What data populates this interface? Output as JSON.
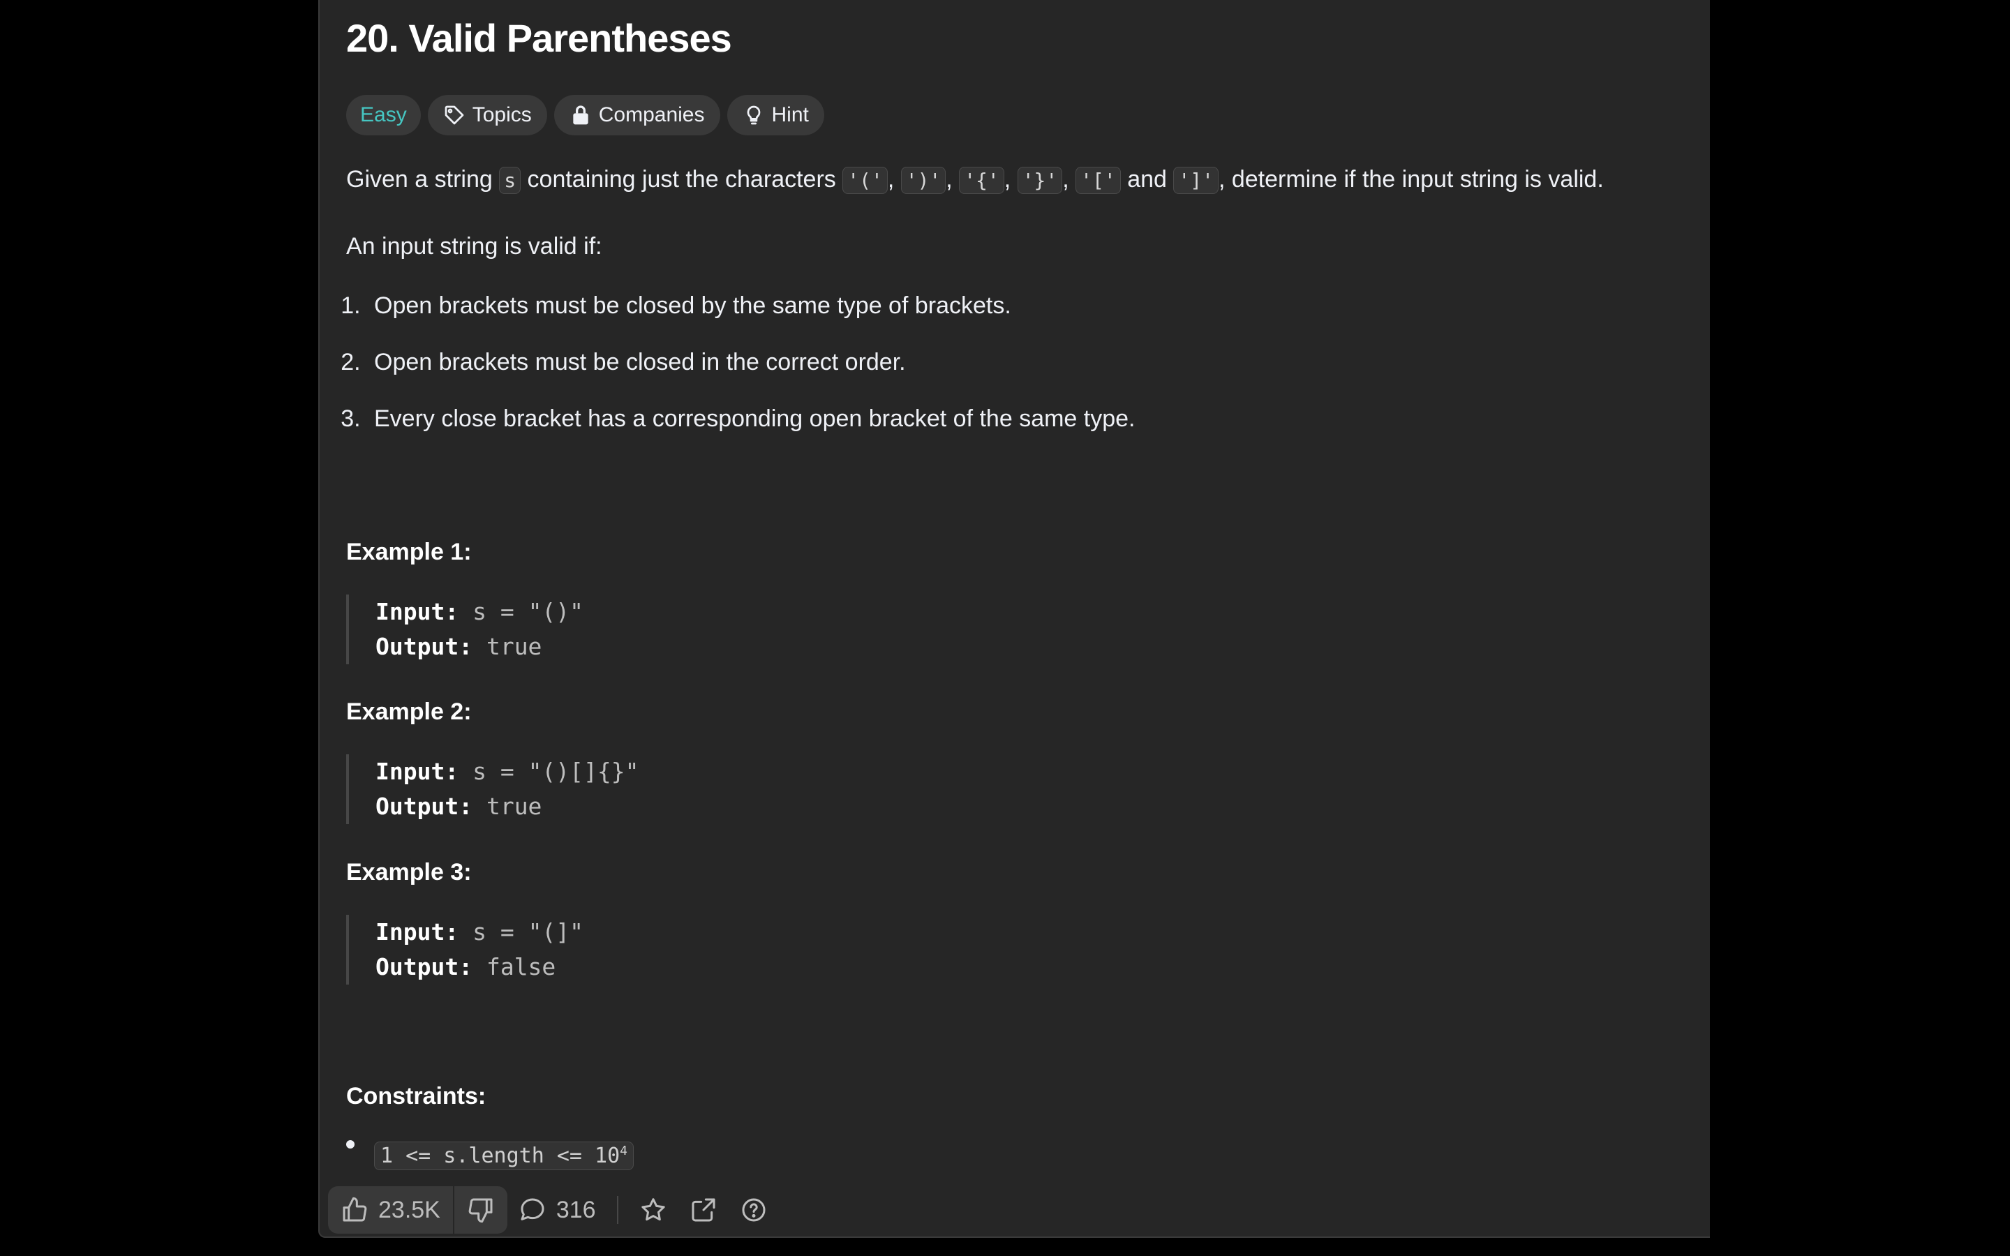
{
  "problem": {
    "title": "20. Valid Parentheses",
    "tags": {
      "difficulty": "Easy",
      "topics": "Topics",
      "companies": "Companies",
      "hint": "Hint"
    },
    "description": {
      "p1_prefix": "Given a string",
      "p1_var": "s",
      "p1_mid": "containing just the characters",
      "chars": [
        "'('",
        "')'",
        "'{'",
        "'}'",
        "'['",
        "']'"
      ],
      "comma": ",",
      "and_word": "and",
      "p1_suffix": ", determine if the input string is valid.",
      "p2": "An input string is valid if:"
    },
    "rules": [
      "Open brackets must be closed by the same type of brackets.",
      "Open brackets must be closed in the correct order.",
      "Every close bracket has a corresponding open bracket of the same type."
    ],
    "examples": [
      {
        "title": "Example 1:",
        "input_label": "Input:",
        "input": "s = \"()\"",
        "output_label": "Output:",
        "output": "true"
      },
      {
        "title": "Example 2:",
        "input_label": "Input:",
        "input": "s = \"()[]{}\"",
        "output_label": "Output:",
        "output": "true"
      },
      {
        "title": "Example 3:",
        "input_label": "Input:",
        "input": "s = \"(]\"",
        "output_label": "Output:",
        "output": "false"
      }
    ],
    "constraints_title": "Constraints:",
    "constraint": {
      "base": "1 <= s.length <= 10",
      "exp": "4"
    }
  },
  "footer": {
    "likes": "23.5K",
    "comments": "316"
  },
  "icons": [
    "tag-icon",
    "lock-icon",
    "lightbulb-icon",
    "thumbs-up-icon",
    "thumbs-down-icon",
    "comment-icon",
    "star-icon",
    "share-icon",
    "help-icon"
  ],
  "colors": {
    "background": "#000000",
    "panel": "#262626",
    "easy": "#46c6c2",
    "chip": "#393939"
  }
}
